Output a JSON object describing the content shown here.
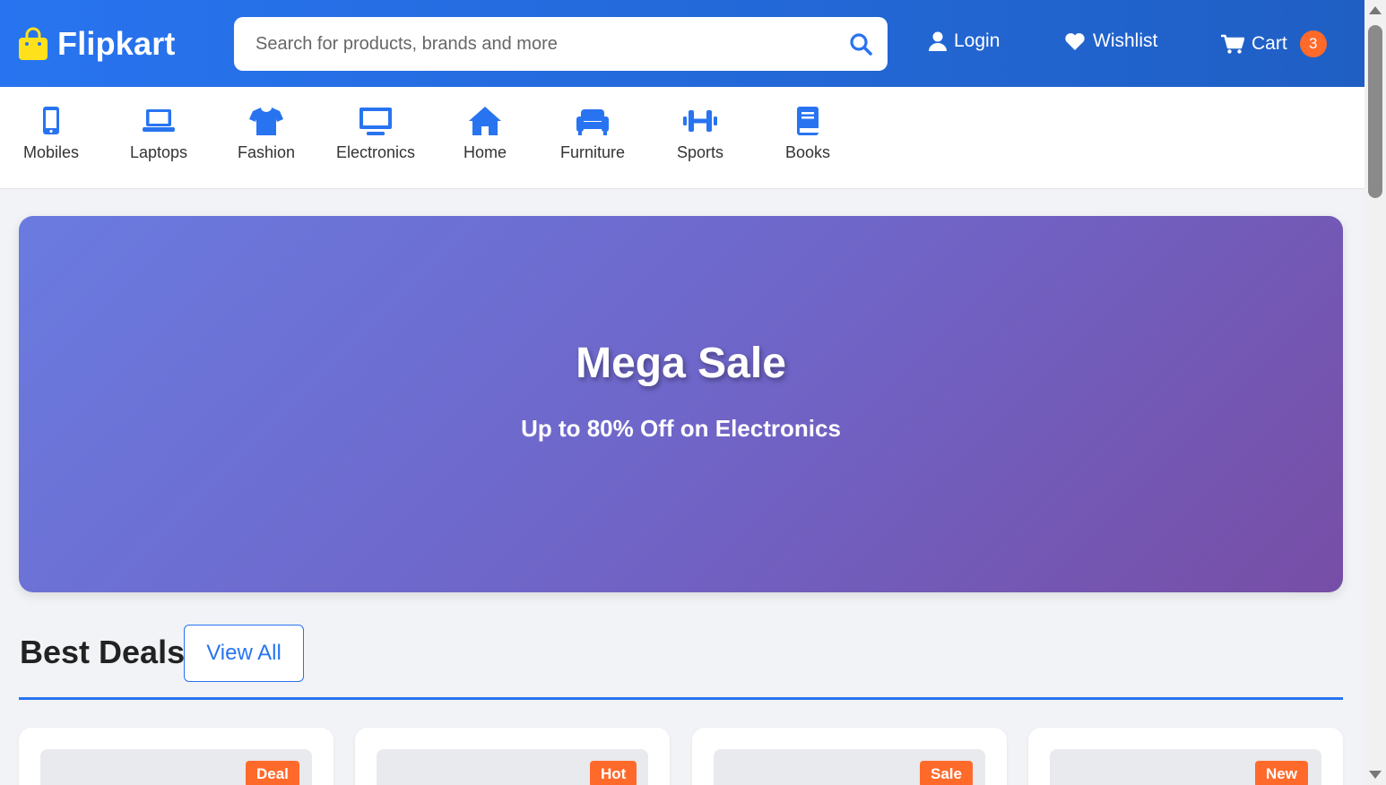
{
  "header": {
    "logo_text": "Flipkart",
    "search_placeholder": "Search for products, brands and more",
    "login_label": "Login",
    "wishlist_label": "Wishlist",
    "cart_label": "Cart",
    "cart_count": "3"
  },
  "categories": [
    {
      "label": "Mobiles",
      "icon": "mobile-icon"
    },
    {
      "label": "Laptops",
      "icon": "laptop-icon"
    },
    {
      "label": "Fashion",
      "icon": "tshirt-icon"
    },
    {
      "label": "Electronics",
      "icon": "monitor-icon"
    },
    {
      "label": "Home",
      "icon": "home-icon"
    },
    {
      "label": "Furniture",
      "icon": "couch-icon"
    },
    {
      "label": "Sports",
      "icon": "dumbbell-icon"
    },
    {
      "label": "Books",
      "icon": "book-icon"
    }
  ],
  "banner": {
    "title": "Mega Sale",
    "subtitle": "Up to 80% Off on Electronics"
  },
  "deals": {
    "title": "Best Deals",
    "view_all_label": "View All",
    "cards": [
      {
        "badge": "Deal"
      },
      {
        "badge": "Hot"
      },
      {
        "badge": "Sale"
      },
      {
        "badge": "New"
      }
    ]
  },
  "colors": {
    "brand": "#2874f0",
    "accent": "#ff6a2b",
    "logo_bag": "#ffe11b"
  }
}
